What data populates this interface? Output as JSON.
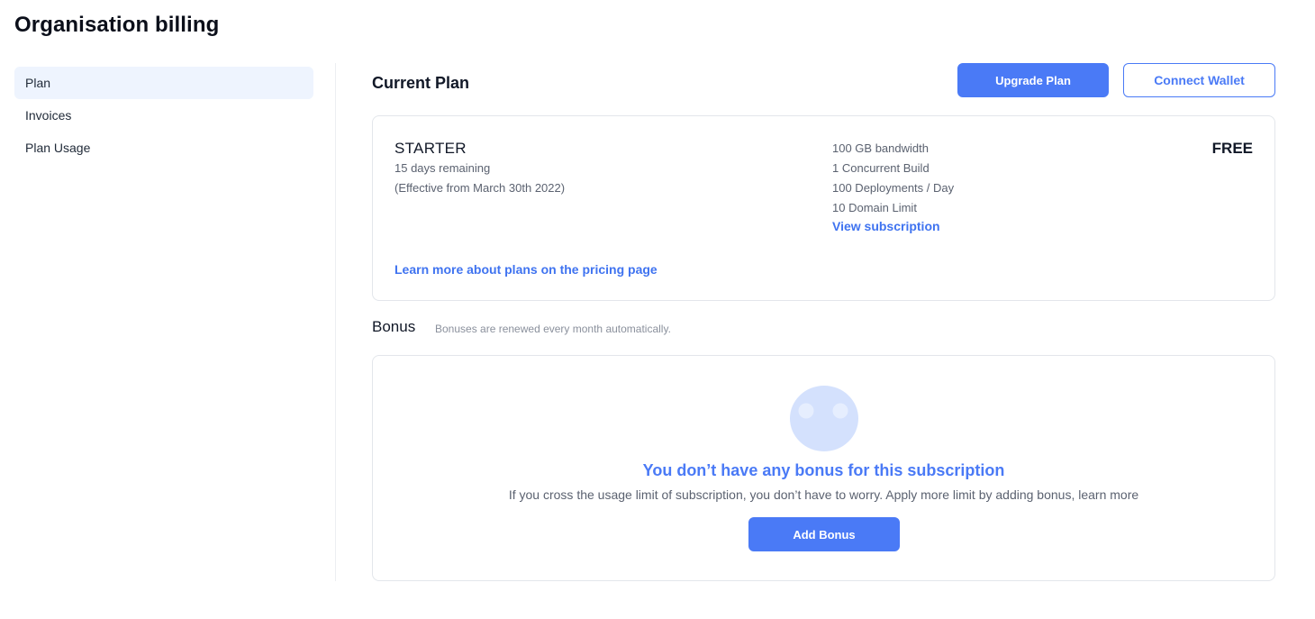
{
  "page": {
    "title": "Organisation billing"
  },
  "sidebar": {
    "items": [
      {
        "label": "Plan",
        "active": true
      },
      {
        "label": "Invoices",
        "active": false
      },
      {
        "label": "Plan Usage",
        "active": false
      }
    ]
  },
  "current_plan": {
    "section_title": "Current Plan",
    "upgrade_label": "Upgrade Plan",
    "connect_wallet_label": "Connect Wallet",
    "plan_name": "STARTER",
    "remaining": "15 days remaining",
    "effective": "(Effective from March 30th 2022)",
    "features": [
      "100 GB bandwidth",
      "1 Concurrent Build",
      "100 Deployments / Day",
      "10 Domain Limit"
    ],
    "view_subscription_label": "View subscription",
    "price": "FREE",
    "learn_more_label": "Learn more about plans on the pricing page"
  },
  "bonus": {
    "title": "Bonus",
    "hint": "Bonuses are renewed every month automatically.",
    "empty_title": "You don’t have any bonus for this subscription",
    "empty_desc": "If you cross the usage limit of subscription, you don’t have to worry. Apply more limit by adding bonus, learn more",
    "add_label": "Add Bonus",
    "illustration_icon": "empty-face-icon"
  },
  "colors": {
    "accent": "#4a7af6",
    "active_bg": "#eef4fe",
    "border": "#e3e6eb",
    "illustration": "#d4e1fd"
  }
}
